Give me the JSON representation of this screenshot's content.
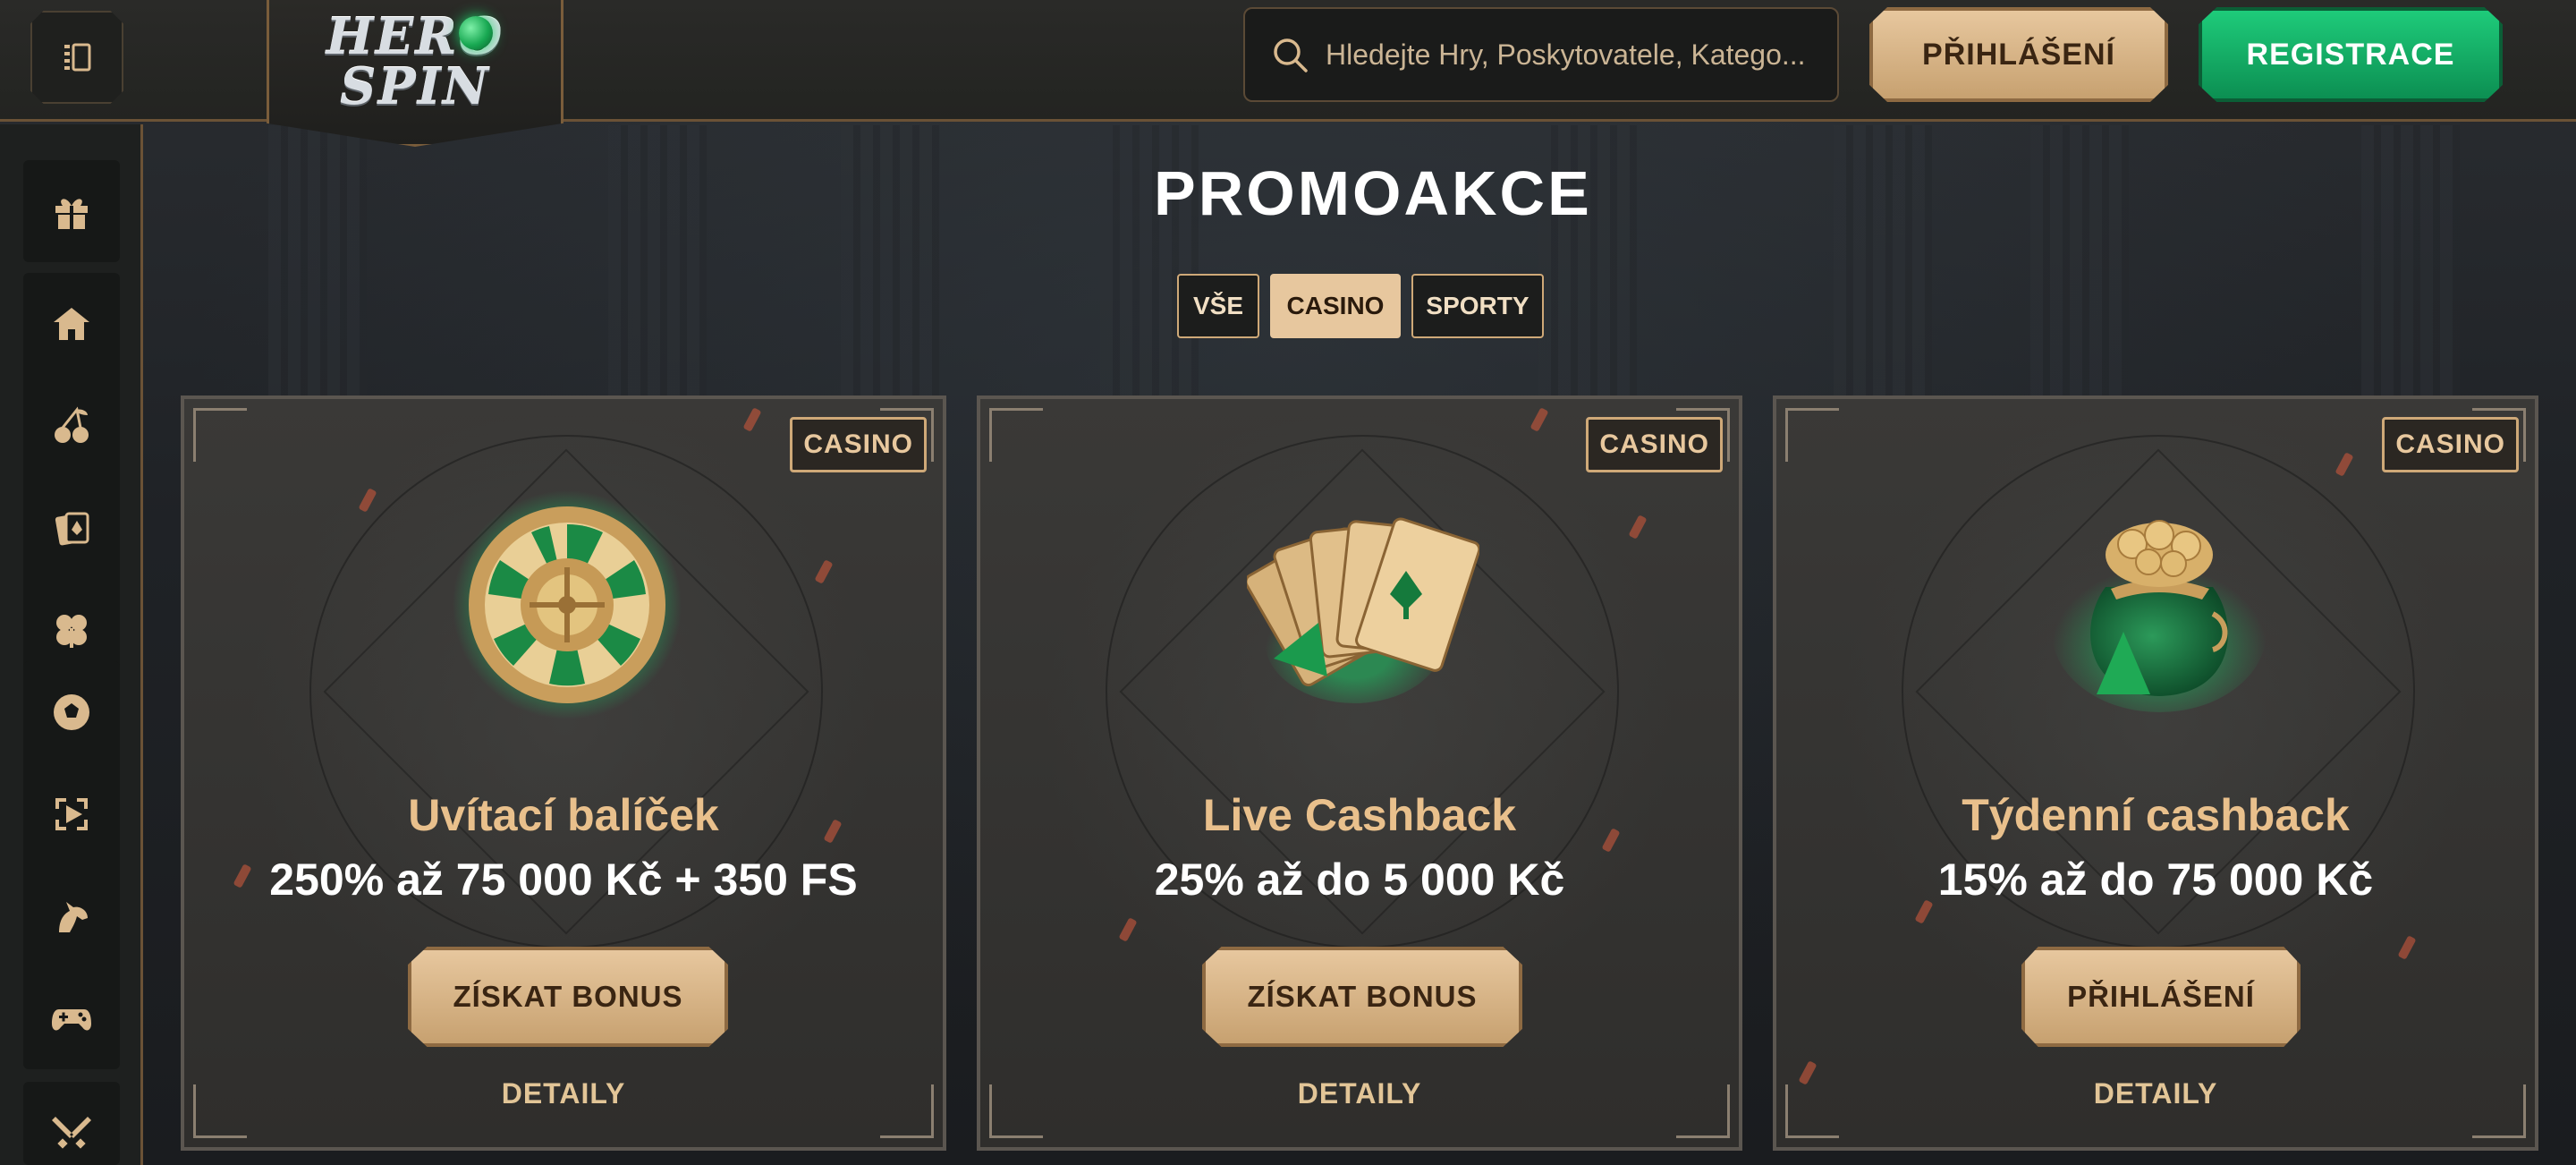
{
  "header": {
    "logo_top": "HERO",
    "logo_bottom": "SPIN",
    "search_placeholder": "Hledejte Hry, Poskytovatele, Katego...",
    "login_label": "PŘIHLÁŠENÍ",
    "register_label": "REGISTRACE"
  },
  "sidebar": {
    "items": [
      {
        "icon": "gift-icon"
      },
      {
        "icon": "home-icon"
      },
      {
        "icon": "cherry-icon"
      },
      {
        "icon": "cards-icon"
      },
      {
        "icon": "clover-icon"
      },
      {
        "icon": "football-icon"
      },
      {
        "icon": "live-play-icon"
      },
      {
        "icon": "horse-icon"
      },
      {
        "icon": "gamepad-icon"
      },
      {
        "icon": "swords-icon"
      }
    ]
  },
  "main": {
    "title": "PROMOAKCE",
    "filters": [
      {
        "label": "VŠE",
        "active": false
      },
      {
        "label": "CASINO",
        "active": true
      },
      {
        "label": "SPORTY",
        "active": false
      }
    ],
    "cards": [
      {
        "badge": "CASINO",
        "art": "roulette-wheel",
        "title": "Uvítací balíček",
        "offer": "250% až 75 000 Kč + 350 FS",
        "button": "ZÍSKAT BONUS",
        "detail": "DETAILY"
      },
      {
        "badge": "CASINO",
        "art": "playing-cards",
        "title": "Live Cashback",
        "offer": "25% až do 5 000 Kč",
        "button": "ZÍSKAT BONUS",
        "detail": "DETAILY"
      },
      {
        "badge": "CASINO",
        "art": "money-bag",
        "title": "Týdenní cashback",
        "offer": "15% až do 75 000 Kč",
        "button": "PŘIHLÁŠENÍ",
        "detail": "DETAILY"
      }
    ]
  },
  "colors": {
    "accent_gold": "#e7c79e",
    "accent_green": "#1ecb7a",
    "card_title": "#e9c08c"
  }
}
